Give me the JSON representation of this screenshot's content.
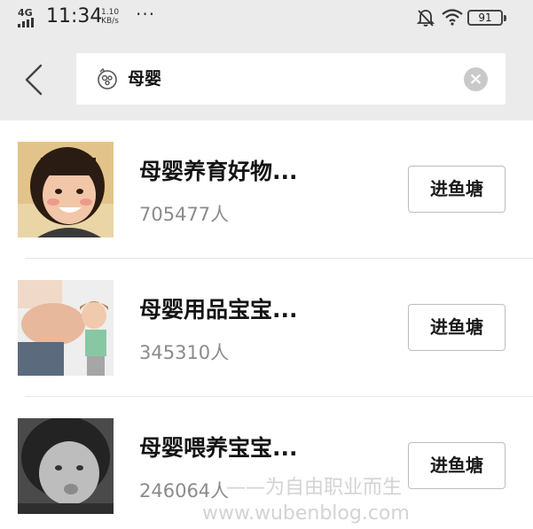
{
  "status_bar": {
    "network": "4G",
    "time": "11:34",
    "speed_value": "1.10",
    "speed_unit": "KB/s",
    "more": "···",
    "battery": "91"
  },
  "search": {
    "query": "母婴",
    "icons": {
      "back": "back-arrow-icon",
      "logo": "fish-logo-icon",
      "clear": "clear-icon"
    }
  },
  "groups": [
    {
      "title": "母婴养育好物...",
      "members": "705477人",
      "button": "进鱼塘"
    },
    {
      "title": "母婴用品宝宝...",
      "members": "345310人",
      "button": "进鱼塘"
    },
    {
      "title": "母婴喂养宝宝...",
      "members": "246064人",
      "button": "进鱼塘"
    }
  ],
  "watermark": {
    "line1": "——为自由职业而生",
    "line2": "www.wubenblog.com"
  }
}
